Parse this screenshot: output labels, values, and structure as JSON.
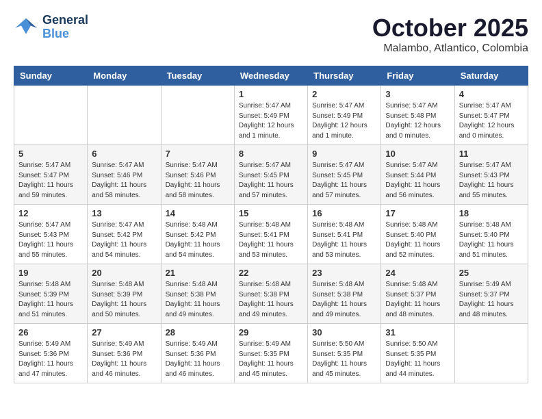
{
  "logo": {
    "line1": "General",
    "line2": "Blue"
  },
  "title": "October 2025",
  "subtitle": "Malambo, Atlantico, Colombia",
  "days_of_week": [
    "Sunday",
    "Monday",
    "Tuesday",
    "Wednesday",
    "Thursday",
    "Friday",
    "Saturday"
  ],
  "weeks": [
    [
      {
        "day": "",
        "info": ""
      },
      {
        "day": "",
        "info": ""
      },
      {
        "day": "",
        "info": ""
      },
      {
        "day": "1",
        "info": "Sunrise: 5:47 AM\nSunset: 5:49 PM\nDaylight: 12 hours\nand 1 minute."
      },
      {
        "day": "2",
        "info": "Sunrise: 5:47 AM\nSunset: 5:49 PM\nDaylight: 12 hours\nand 1 minute."
      },
      {
        "day": "3",
        "info": "Sunrise: 5:47 AM\nSunset: 5:48 PM\nDaylight: 12 hours\nand 0 minutes."
      },
      {
        "day": "4",
        "info": "Sunrise: 5:47 AM\nSunset: 5:47 PM\nDaylight: 12 hours\nand 0 minutes."
      }
    ],
    [
      {
        "day": "5",
        "info": "Sunrise: 5:47 AM\nSunset: 5:47 PM\nDaylight: 11 hours\nand 59 minutes."
      },
      {
        "day": "6",
        "info": "Sunrise: 5:47 AM\nSunset: 5:46 PM\nDaylight: 11 hours\nand 58 minutes."
      },
      {
        "day": "7",
        "info": "Sunrise: 5:47 AM\nSunset: 5:46 PM\nDaylight: 11 hours\nand 58 minutes."
      },
      {
        "day": "8",
        "info": "Sunrise: 5:47 AM\nSunset: 5:45 PM\nDaylight: 11 hours\nand 57 minutes."
      },
      {
        "day": "9",
        "info": "Sunrise: 5:47 AM\nSunset: 5:45 PM\nDaylight: 11 hours\nand 57 minutes."
      },
      {
        "day": "10",
        "info": "Sunrise: 5:47 AM\nSunset: 5:44 PM\nDaylight: 11 hours\nand 56 minutes."
      },
      {
        "day": "11",
        "info": "Sunrise: 5:47 AM\nSunset: 5:43 PM\nDaylight: 11 hours\nand 55 minutes."
      }
    ],
    [
      {
        "day": "12",
        "info": "Sunrise: 5:47 AM\nSunset: 5:43 PM\nDaylight: 11 hours\nand 55 minutes."
      },
      {
        "day": "13",
        "info": "Sunrise: 5:47 AM\nSunset: 5:42 PM\nDaylight: 11 hours\nand 54 minutes."
      },
      {
        "day": "14",
        "info": "Sunrise: 5:48 AM\nSunset: 5:42 PM\nDaylight: 11 hours\nand 54 minutes."
      },
      {
        "day": "15",
        "info": "Sunrise: 5:48 AM\nSunset: 5:41 PM\nDaylight: 11 hours\nand 53 minutes."
      },
      {
        "day": "16",
        "info": "Sunrise: 5:48 AM\nSunset: 5:41 PM\nDaylight: 11 hours\nand 53 minutes."
      },
      {
        "day": "17",
        "info": "Sunrise: 5:48 AM\nSunset: 5:40 PM\nDaylight: 11 hours\nand 52 minutes."
      },
      {
        "day": "18",
        "info": "Sunrise: 5:48 AM\nSunset: 5:40 PM\nDaylight: 11 hours\nand 51 minutes."
      }
    ],
    [
      {
        "day": "19",
        "info": "Sunrise: 5:48 AM\nSunset: 5:39 PM\nDaylight: 11 hours\nand 51 minutes."
      },
      {
        "day": "20",
        "info": "Sunrise: 5:48 AM\nSunset: 5:39 PM\nDaylight: 11 hours\nand 50 minutes."
      },
      {
        "day": "21",
        "info": "Sunrise: 5:48 AM\nSunset: 5:38 PM\nDaylight: 11 hours\nand 49 minutes."
      },
      {
        "day": "22",
        "info": "Sunrise: 5:48 AM\nSunset: 5:38 PM\nDaylight: 11 hours\nand 49 minutes."
      },
      {
        "day": "23",
        "info": "Sunrise: 5:48 AM\nSunset: 5:38 PM\nDaylight: 11 hours\nand 49 minutes."
      },
      {
        "day": "24",
        "info": "Sunrise: 5:48 AM\nSunset: 5:37 PM\nDaylight: 11 hours\nand 48 minutes."
      },
      {
        "day": "25",
        "info": "Sunrise: 5:49 AM\nSunset: 5:37 PM\nDaylight: 11 hours\nand 48 minutes."
      }
    ],
    [
      {
        "day": "26",
        "info": "Sunrise: 5:49 AM\nSunset: 5:36 PM\nDaylight: 11 hours\nand 47 minutes."
      },
      {
        "day": "27",
        "info": "Sunrise: 5:49 AM\nSunset: 5:36 PM\nDaylight: 11 hours\nand 46 minutes."
      },
      {
        "day": "28",
        "info": "Sunrise: 5:49 AM\nSunset: 5:36 PM\nDaylight: 11 hours\nand 46 minutes."
      },
      {
        "day": "29",
        "info": "Sunrise: 5:49 AM\nSunset: 5:35 PM\nDaylight: 11 hours\nand 45 minutes."
      },
      {
        "day": "30",
        "info": "Sunrise: 5:50 AM\nSunset: 5:35 PM\nDaylight: 11 hours\nand 45 minutes."
      },
      {
        "day": "31",
        "info": "Sunrise: 5:50 AM\nSunset: 5:35 PM\nDaylight: 11 hours\nand 44 minutes."
      },
      {
        "day": "",
        "info": ""
      }
    ]
  ]
}
